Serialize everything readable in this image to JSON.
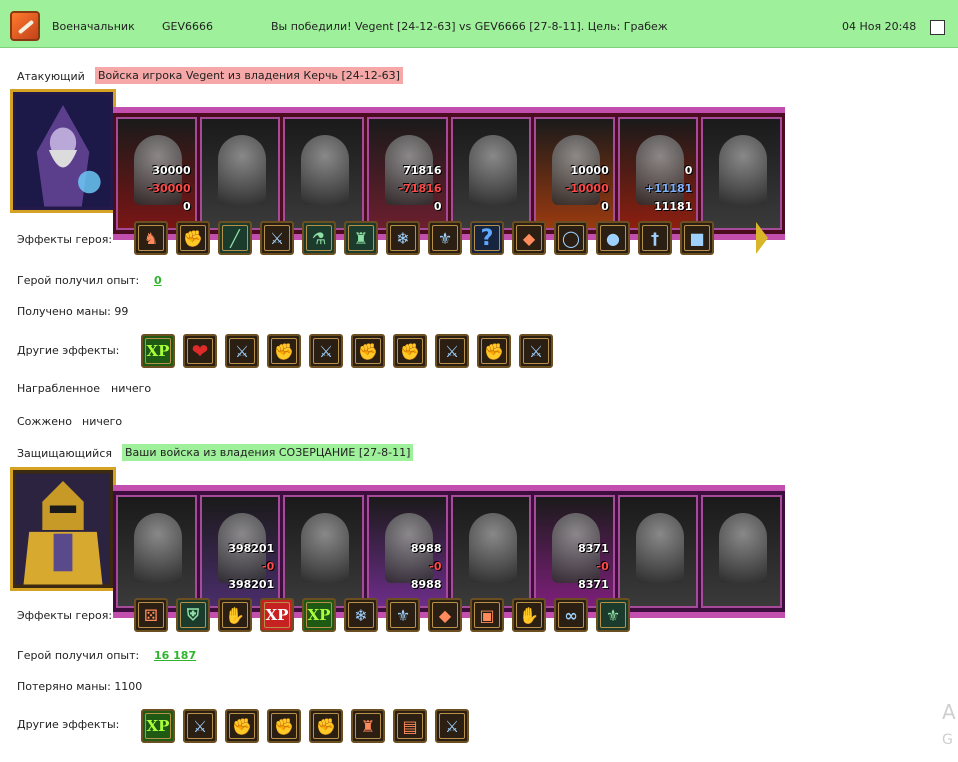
{
  "header": {
    "title": "Военачальник",
    "player": "GEV6666",
    "battle_summary": "Вы победили! Vegent [24-12-63] vs GEV6666 [27-8-11]. Цель: Грабеж",
    "datetime": "04 Ноя 20:48"
  },
  "attacker": {
    "label": "Атакующий",
    "description": "Войска игрока Vegent из владения Керчь [24-12-63]",
    "units": [
      {
        "top": "30000",
        "mid": "-30000",
        "bottom": "0",
        "hue": "#7a1515"
      },
      {
        "top": "",
        "mid": "",
        "bottom": "",
        "hue": "#3a3a3a"
      },
      {
        "top": "",
        "mid": "",
        "bottom": "",
        "hue": "#3a3a3a"
      },
      {
        "top": "71816",
        "mid": "-71816",
        "bottom": "0",
        "hue": "#6b1f2e"
      },
      {
        "top": "",
        "mid": "",
        "bottom": "",
        "hue": "#3a3a3a"
      },
      {
        "top": "10000",
        "mid": "-10000",
        "bottom": "0",
        "hue": "#9a3a10"
      },
      {
        "top": "0",
        "mid": "+11181",
        "bottom": "11181",
        "hue": "#8c1f10"
      },
      {
        "top": "",
        "mid": "",
        "bottom": "",
        "hue": "#3a3a3a"
      }
    ],
    "hero_effects_label": "Эффекты героя:",
    "hero_effects": [
      "paladin-icon",
      "fist-icon",
      "staff-icon",
      "sword-icon",
      "potion-icon",
      "tower-icon",
      "frost-icon",
      "crest-icon",
      "question-icon",
      "armor-icon",
      "ring-icon",
      "orb-icon",
      "dagger-icon",
      "cloak-icon"
    ],
    "exp_label": "Герой получил опыт:",
    "exp_value": "0",
    "mana_text": "Получено маны: 99",
    "other_effects_label": "Другие эффекты:",
    "other_effects": [
      "xp-icon",
      "heart-icon",
      "sword-icon",
      "fist-icon",
      "sword-icon",
      "fist-icon",
      "fist-icon",
      "sword-icon",
      "fist-icon",
      "sword-icon"
    ],
    "loot_label": "Награбленное",
    "loot_value": "ничего",
    "burned_label": "Сожжено",
    "burned_value": "ничего"
  },
  "defender": {
    "label": "Защищающийся",
    "description": "Ваши войска из владения СОЗЕРЦАНИЕ [27-8-11]",
    "units": [
      {
        "top": "",
        "mid": "",
        "bottom": "",
        "hue": "#3a3a3a"
      },
      {
        "top": "398201",
        "mid": "-0",
        "bottom": "398201",
        "hue": "#4a2d6b"
      },
      {
        "top": "",
        "mid": "",
        "bottom": "",
        "hue": "#3a3a3a"
      },
      {
        "top": "8988",
        "mid": "-0",
        "bottom": "8988",
        "hue": "#6d2d8a"
      },
      {
        "top": "",
        "mid": "",
        "bottom": "",
        "hue": "#3a3a3a"
      },
      {
        "top": "8371",
        "mid": "-0",
        "bottom": "8371",
        "hue": "#7d1f7a"
      },
      {
        "top": "",
        "mid": "",
        "bottom": "",
        "hue": "#3a3a3a"
      },
      {
        "top": "",
        "mid": "",
        "bottom": "",
        "hue": "#3a3a3a"
      }
    ],
    "hero_effects_label": "Эффекты героя:",
    "hero_effects": [
      "dice-fist-icon",
      "shield-icon",
      "handshake-icon",
      "xp-icon",
      "knight-xp-icon",
      "frost-icon",
      "crest-icon",
      "armor-icon",
      "boots-icon",
      "gauntlet-icon",
      "chain-icon",
      "lily-icon"
    ],
    "exp_label": "Герой получил опыт:",
    "exp_value": "16 187",
    "mana_text": "Потеряно маны: 1100",
    "other_effects_label": "Другие эффекты:",
    "other_effects": [
      "xp-icon",
      "sword-icon",
      "fist-icon",
      "fist-icon",
      "fist-icon",
      "fort-icon",
      "totem-icon",
      "sword-icon"
    ]
  },
  "corner": {
    "char1": "A",
    "char2": "G"
  }
}
